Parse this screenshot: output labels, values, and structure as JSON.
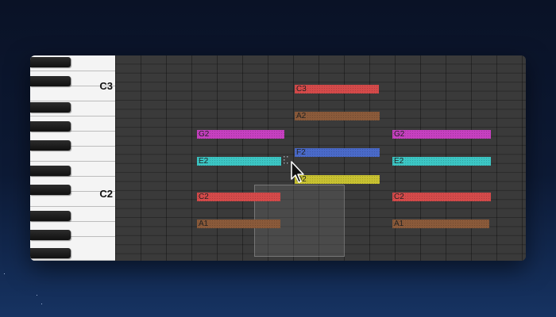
{
  "piano_roll": {
    "octave_labels": {
      "c3": "C3",
      "c2": "C2"
    },
    "notes": [
      {
        "label": "C3",
        "color": "#d44a4a"
      },
      {
        "label": "A2",
        "color": "#8a5a3a"
      },
      {
        "label": "G2",
        "color": "#c640c0"
      },
      {
        "label": "E2",
        "color": "#3cc6c4"
      },
      {
        "label": "F2",
        "color": "#4a6ac9"
      },
      {
        "label": "D2",
        "color": "#c8c231"
      },
      {
        "label": "C2",
        "color": "#d44a4a"
      },
      {
        "label": "A1",
        "color": "#8a5a3a"
      },
      {
        "label": "G2",
        "color": "#c640c0"
      },
      {
        "label": "E2",
        "color": "#3cc6c4"
      },
      {
        "label": "C2",
        "color": "#d44a4a"
      },
      {
        "label": "A1",
        "color": "#8a5a3a"
      }
    ]
  }
}
